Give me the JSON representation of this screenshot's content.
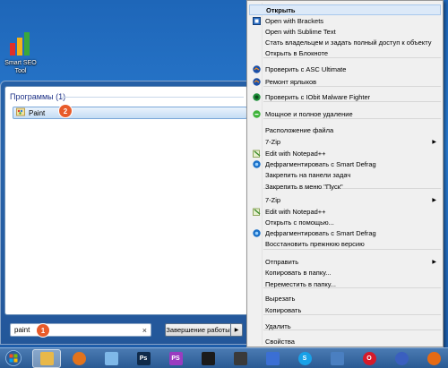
{
  "desktop": {
    "icon_label_1": "Smart SEO",
    "icon_label_2": "Tool"
  },
  "start_menu": {
    "results_heading": "Программы (1)",
    "result_item": "Paint",
    "search_value": "paint",
    "search_clear": "×",
    "shutdown_label": "Завершение работы",
    "shutdown_arrow": "▶"
  },
  "badges": {
    "one": "1",
    "two": "2",
    "three": "3"
  },
  "context_menu": {
    "items": [
      {
        "label": "Открыть",
        "icon": "none",
        "bold": true,
        "highlight": true
      },
      {
        "label": "Open with Brackets",
        "icon": "brackets-icon"
      },
      {
        "label": "Open with Sublime Text",
        "icon": "none"
      },
      {
        "label": "Стать владельцем и задать полный доступ к объекту",
        "icon": "none"
      },
      {
        "label": "Открыть в Блокноте",
        "icon": "none"
      },
      {
        "label": "Проверить с ASC Ultimate",
        "icon": "asc-icon"
      },
      {
        "label": "Ремонт ярлыков",
        "icon": "asc-icon"
      },
      {
        "label": "Проверить с IObit Malware Fighter",
        "icon": "iobit-icon"
      },
      {
        "label": "Мощное и полное удаление",
        "icon": "uninstaller-icon"
      },
      {
        "label": "Расположение файла",
        "icon": "none"
      },
      {
        "label": "7-Zip",
        "icon": "none",
        "submenu": true
      },
      {
        "label": "Edit with Notepad++",
        "icon": "notepadpp-icon"
      },
      {
        "label": "Дефрагментировать с Smart Defrag",
        "icon": "smart-defrag-icon"
      },
      {
        "label": "Закрепить на панели задач",
        "icon": "none"
      },
      {
        "label": "Закрепить в меню \"Пуск\"",
        "icon": "none"
      },
      {
        "label": "7-Zip",
        "icon": "none",
        "submenu": true
      },
      {
        "label": "Edit with Notepad++",
        "icon": "notepadpp-icon"
      },
      {
        "label": "Открыть с помощью...",
        "icon": "none"
      },
      {
        "label": "Дефрагментировать с Smart Defrag",
        "icon": "smart-defrag-icon"
      },
      {
        "label": "Восстановить прежнюю версию",
        "icon": "none"
      },
      {
        "label": "Отправить",
        "icon": "none",
        "submenu": true
      },
      {
        "label": "Копировать в папку...",
        "icon": "none"
      },
      {
        "label": "Переместить в папку...",
        "icon": "none"
      },
      {
        "label": "Вырезать",
        "icon": "none"
      },
      {
        "label": "Копировать",
        "icon": "none"
      },
      {
        "label": "Удалить",
        "icon": "none"
      },
      {
        "label": "Свойства",
        "icon": "none"
      }
    ],
    "submenu_arrow": "▶"
  },
  "taskbar": {
    "apps": [
      {
        "name": "explorer-icon",
        "color": "#e8b84a"
      },
      {
        "name": "app-orange-icon",
        "color": "#e2731c"
      },
      {
        "name": "paint-icon",
        "color": "#7fb8e8"
      },
      {
        "name": "photoshop-icon",
        "color": "#0f2a4a",
        "text": "Ps"
      },
      {
        "name": "phpstorm-icon",
        "color": "#9a3cc0",
        "text": "PS"
      },
      {
        "name": "grid-app-icon",
        "color": "#1b1b1b"
      },
      {
        "name": "terminal-icon",
        "color": "#3a3a3a"
      },
      {
        "name": "tool-icon",
        "color": "#3b6fd4"
      },
      {
        "name": "skype-icon",
        "color": "#18a1e8",
        "text": "S"
      },
      {
        "name": "winscp-icon",
        "color": "#4a7fc1"
      },
      {
        "name": "opera-icon",
        "color": "#d61a2a",
        "text": "O"
      },
      {
        "name": "network-icon",
        "color": "#3a5fbf"
      },
      {
        "name": "firefox-icon",
        "color": "#e66a14"
      },
      {
        "name": "chrome-icon",
        "color": "#4285f4"
      }
    ]
  }
}
